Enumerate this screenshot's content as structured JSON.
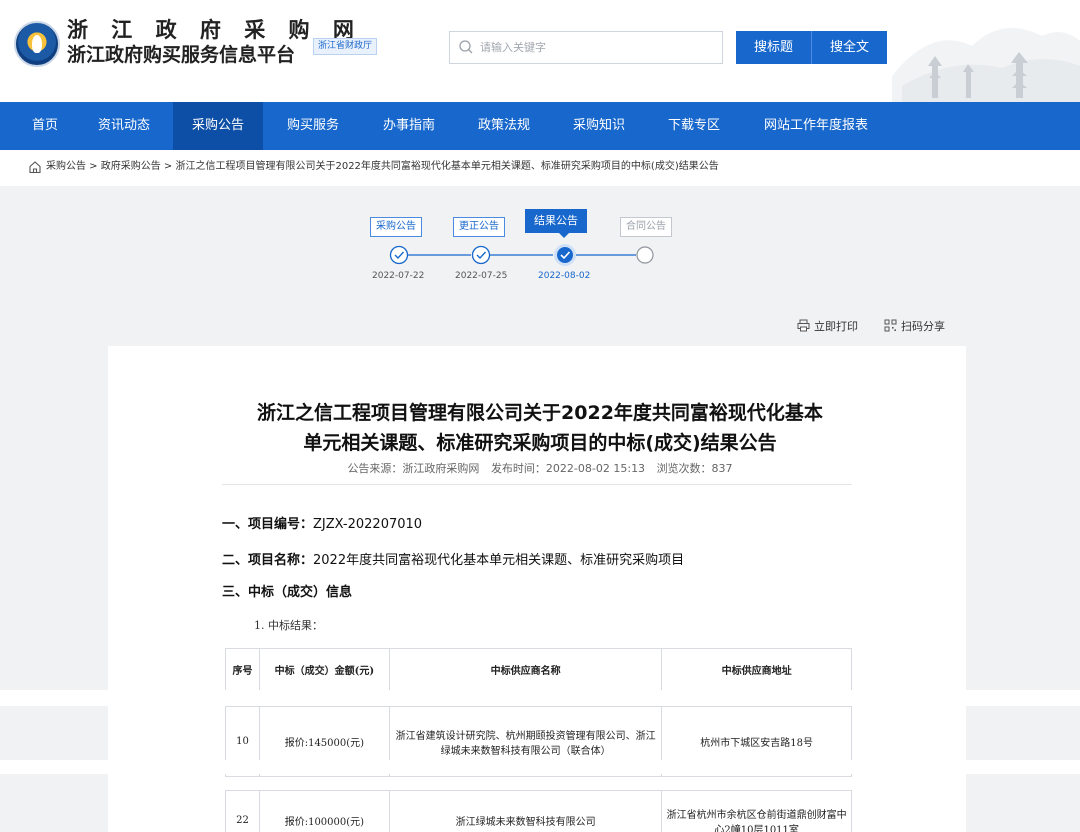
{
  "header": {
    "site_name": "浙 江 政 府 采 购 网",
    "site_subname": "浙江政府购买服务信息平台",
    "dept_badge": "浙江省财政厅",
    "search_placeholder": "请输入关键字",
    "btn_title_search": "搜标题",
    "btn_full_search": "搜全文"
  },
  "nav": {
    "items": [
      "首页",
      "资讯动态",
      "采购公告",
      "购买服务",
      "办事指南",
      "政策法规",
      "采购知识",
      "下载专区",
      "网站工作年度报表"
    ],
    "active_index": 2
  },
  "breadcrumb": "采购公告 > 政府采购公告 > 浙江之信工程项目管理有限公司关于2022年度共同富裕现代化基本单元相关课题、标准研究采购项目的中标(成交)结果公告",
  "steps": [
    {
      "label": "采购公告",
      "date": "2022-07-22",
      "state": "done"
    },
    {
      "label": "更正公告",
      "date": "2022-07-25",
      "state": "done"
    },
    {
      "label": "结果公告",
      "date": "2022-08-02",
      "state": "current"
    },
    {
      "label": "合同公告",
      "date": "",
      "state": "pending"
    }
  ],
  "toolbar": {
    "print": "立即打印",
    "share": "扫码分享"
  },
  "doc": {
    "title_line1": "浙江之信工程项目管理有限公司关于2022年度共同富裕现代化基本",
    "title_line2": "单元相关课题、标准研究采购项目的中标(成交)结果公告",
    "source": "公告来源：浙江政府采购网",
    "publish_time": "发布时间：2022-08-02 15:13",
    "views": "浏览次数：837",
    "sec1_label": "一、项目编号：",
    "sec1_value": "ZJZX-202207010",
    "sec2_label": "二、项目名称：",
    "sec2_value": "2022年度共同富裕现代化基本单元相关课题、标准研究采购项目",
    "sec3_label": "三、中标（成交）信息",
    "sub1": "1. 中标结果："
  },
  "table": {
    "headers": [
      "序号",
      "中标（成交）金额(元)",
      "中标供应商名称",
      "中标供应商地址"
    ],
    "rows": [
      [
        "10",
        "报价:145000(元)",
        "浙江省建筑设计研究院、杭州期颐投资管理有限公司、浙江绿城未来数智科技有限公司（联合体）",
        "杭州市下城区安吉路18号"
      ],
      [
        "22",
        "报价:100000(元)",
        "浙江绿城未来数智科技有限公司",
        "浙江省杭州市余杭区仓前街道鼎创财富中心2幢10层1011室"
      ]
    ]
  },
  "colors": {
    "brand_blue": "#1767cc",
    "nav_active": "#0d4fa6",
    "page_bg": "#f1f2f4"
  }
}
